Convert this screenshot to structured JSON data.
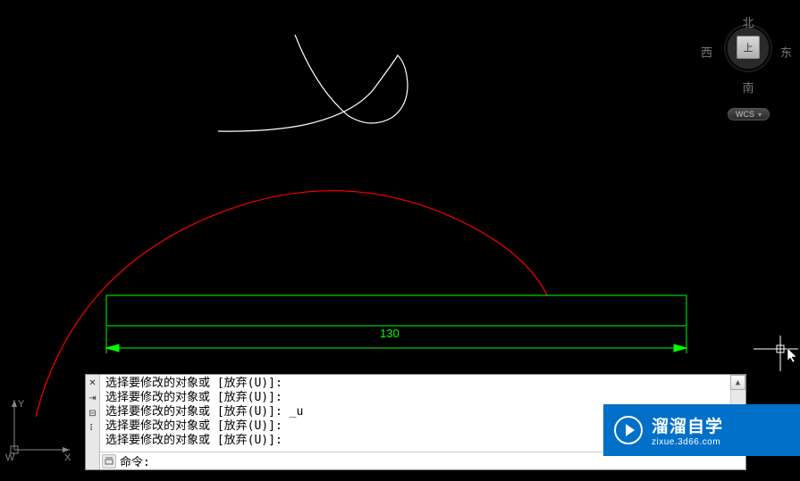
{
  "viewcube": {
    "north": "北",
    "south": "南",
    "east": "东",
    "west": "西",
    "face": "上",
    "wcs": "WCS"
  },
  "ucs": {
    "x": "X",
    "y": "Y",
    "w": "W"
  },
  "dimension": {
    "value": "130"
  },
  "command": {
    "history": [
      "选择要修改的对象或 [放弃(U)]:",
      "选择要修改的对象或 [放弃(U)]:",
      "选择要修改的对象或 [放弃(U)]: _u",
      "选择要修改的对象或 [放弃(U)]:",
      "选择要修改的对象或 [放弃(U)]:"
    ],
    "prompt": "命令:",
    "input": ""
  },
  "watermark": {
    "title": "溜溜自学",
    "url": "zixue.3d66.com"
  },
  "colors": {
    "arc": "#ff0000",
    "rect": "#00ff00",
    "freehand": "#ffffff",
    "dim": "#00ff00"
  }
}
